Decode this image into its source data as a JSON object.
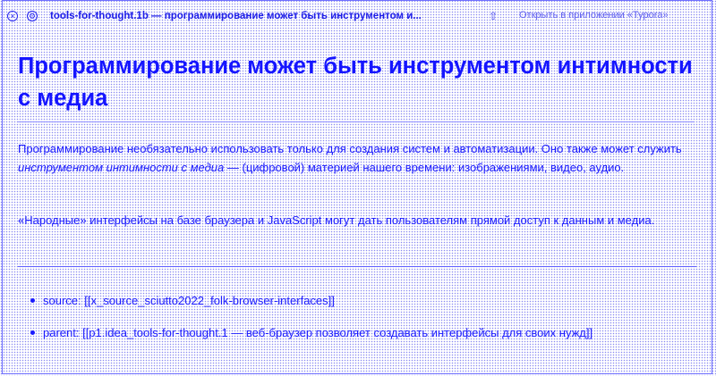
{
  "titlebar": {
    "title": "tools-for-thought.1b — программирование может быть инструментом и...",
    "open_in_app": "Открыть в приложении «Typora»"
  },
  "doc": {
    "heading": "Программирование может быть инструментом интимности с медиа",
    "p1_before": "Программирование необязательно использовать только для создания систем и автоматизации. Оно также может служить ",
    "p1_em": "инструментом интимности с медиа",
    "p1_after": " — (цифровой) материей нашего времени: изображениями, видео, аудио.",
    "p2": "«Народные» интерфейсы на базе браузера и JavaScript могут дать пользователям прямой доступ к данным и медиа.",
    "list": [
      "source: [[x_source_sciutto2022_folk-browser-interfaces]]",
      "parent: [[p1.idea_tools-for-thought.1 — веб-браузер позволяет создавать интерфейсы для своих нужд]]"
    ]
  }
}
